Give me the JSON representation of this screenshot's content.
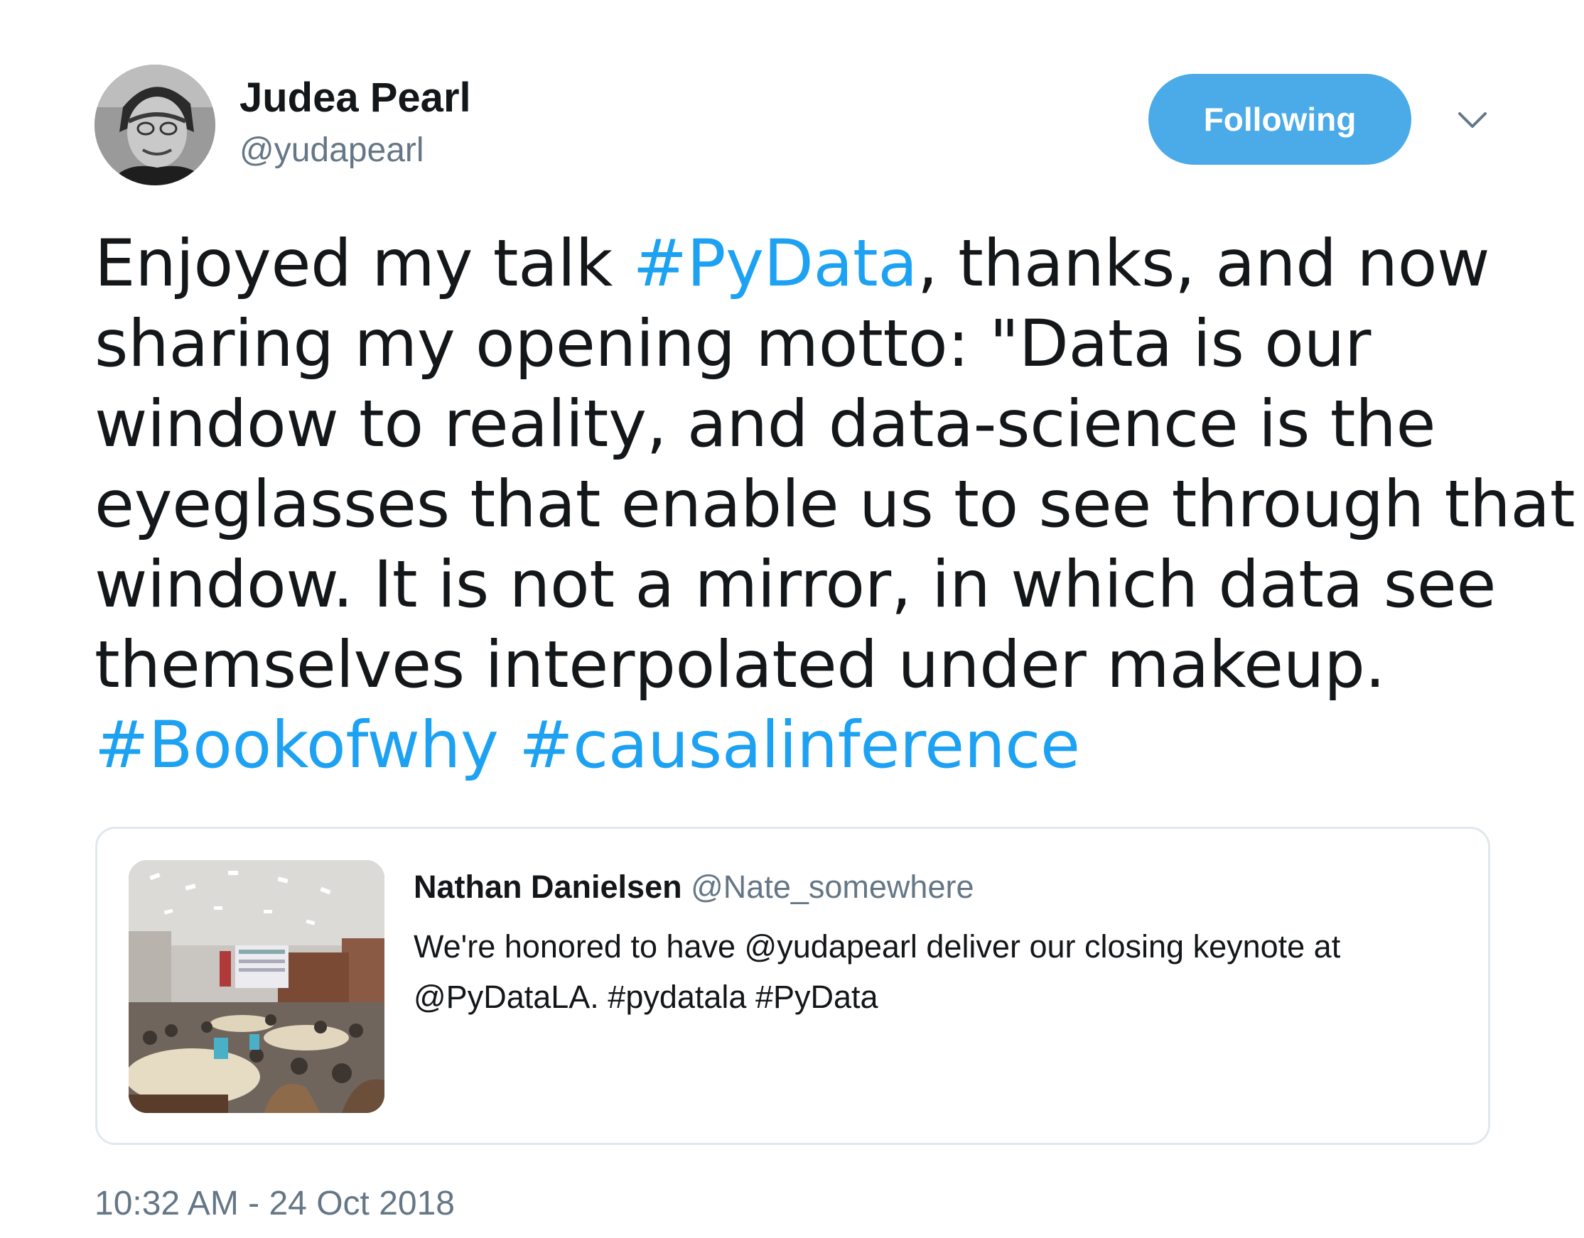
{
  "author": {
    "display_name": "Judea Pearl",
    "handle": "@yudapearl"
  },
  "follow_button": {
    "label": "Following",
    "color": "#4aabe8"
  },
  "menu": {
    "icon": "chevron-down-icon"
  },
  "tweet": {
    "lines": [
      [
        "Enjoyed my talk ",
        "#PyData",
        ", thanks, and now"
      ],
      [
        "sharing my opening motto: \"Data is our"
      ],
      [
        "window to reality, and data-science is the"
      ],
      [
        "eyeglasses that enable us to see through that"
      ],
      [
        "window. It is not a mirror, in which data see"
      ],
      [
        "themselves interpolated under makeup."
      ],
      [
        "#Bookofwhy",
        " ",
        "#causalinference"
      ]
    ],
    "hashtag_color": "#1da1f2"
  },
  "quoted_tweet": {
    "name": "Nathan Danielsen",
    "handle": "@Nate_somewhere",
    "lines": [
      "We're honored to have @yudapearl deliver our closing keynote at",
      "@PyDataLA. #pydatala #PyData"
    ],
    "media": "conference-hall-photo"
  },
  "timestamp": "10:32 AM - 24 Oct 2018"
}
